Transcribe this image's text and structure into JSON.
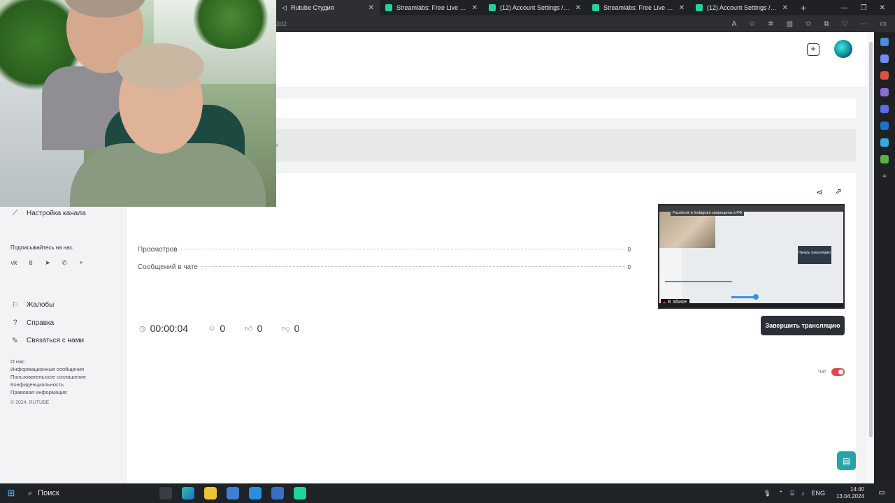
{
  "browser": {
    "tabs": [
      {
        "title": "Rutube Студия",
        "icon": "rutube-icon"
      },
      {
        "title": "Streamlabs: Free Live Streaming",
        "icon": "streamlabs-icon"
      },
      {
        "title": "(12) Account Settings / Stream",
        "icon": "streamlabs-icon"
      },
      {
        "title": "Streamlabs: Free Live Streaming",
        "icon": "streamlabs-icon"
      },
      {
        "title": "(12) Account Settings / Stream",
        "icon": "streamlabs-icon"
      }
    ],
    "new_tab": "+",
    "url_fragment": "3d2"
  },
  "sidebar": {
    "channel_settings": "Настройка канала",
    "follow_label": "Подписывайтесь на нас",
    "socials": [
      "vk",
      "ok",
      "tg",
      "viber",
      "+"
    ],
    "menu": [
      {
        "label": "Жалобы",
        "icon": "flag-icon"
      },
      {
        "label": "Справка",
        "icon": "help-icon"
      },
      {
        "label": "Связаться с нами",
        "icon": "pencil-icon"
      }
    ],
    "footer_links": [
      "О нас",
      "Информационные сообщения",
      "Пользовательское соглашение",
      "Конфиденциальность",
      "Правовая информация"
    ],
    "copyright": "© 2024, RUTUBE"
  },
  "stream": {
    "strip_fragment": "и",
    "stats": [
      {
        "label": "Просмотров",
        "value": "0"
      },
      {
        "label": "Сообщений в чате",
        "value": "0"
      }
    ],
    "duration": "00:00:04",
    "viewers": "0",
    "likes": "0",
    "dislikes": "0",
    "end_button": "Завершить трансляцию",
    "preview": {
      "banner": "Facebook и Instagram запрещены в РФ",
      "button": "Начать трансляцию",
      "live_label": "В эфире"
    }
  },
  "chat": {
    "toggle_label": "Чат",
    "enabled": true
  },
  "taskbar": {
    "search": "Поиск",
    "language": "ENG",
    "time": "14:40",
    "date": "13.04.2024"
  },
  "colors": {
    "accent_red": "#e8434d",
    "fab_teal": "#27a4a8",
    "button_dark": "#2b2f36"
  }
}
